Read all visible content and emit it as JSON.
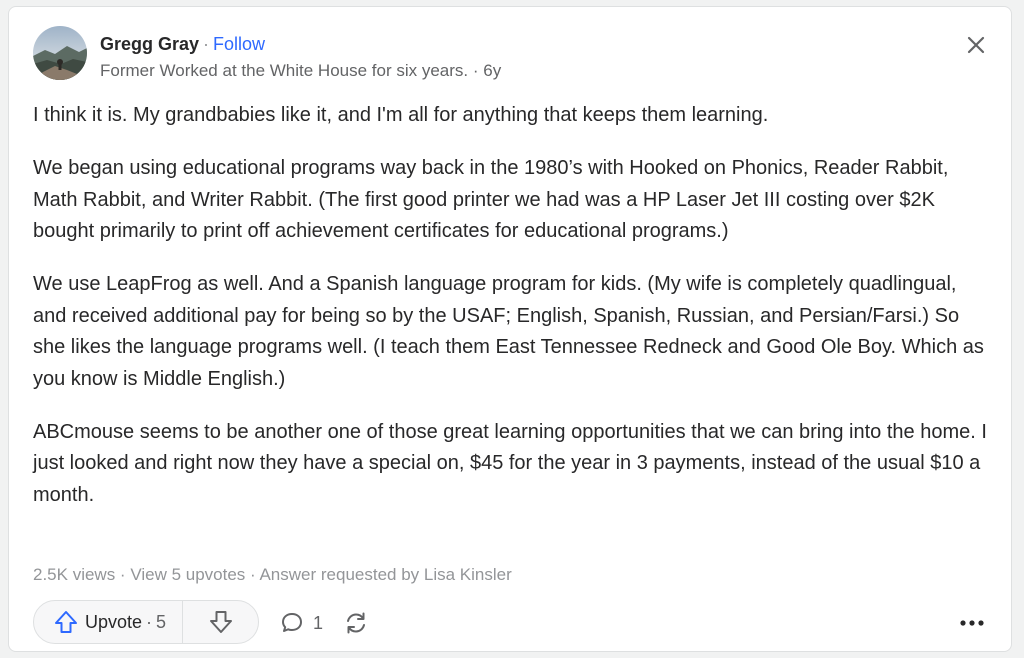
{
  "author": {
    "name": "Gregg Gray",
    "separator": "·",
    "follow_label": "Follow",
    "credential": "Former Worked at the White House for six years. · 6y"
  },
  "answer": {
    "paragraphs": [
      "I think it is. My grandbabies like it, and I'm all for anything that keeps them learning.",
      "We began using educational programs way back in the 1980’s with Hooked on Phonics, Reader Rabbit, Math Rabbit, and Writer Rabbit. (The first good printer we had was a HP Laser Jet III costing over $2K bought primarily to print off achievement certificates for educational programs.)",
      "We use LeapFrog as well. And a Spanish language program for kids. (My wife is completely quadlingual, and received additional pay for being so by the USAF; English, Spanish, Russian, and Persian/Farsi.) So she likes the language programs well. (I teach them East Tennessee Redneck and Good Ole Boy. Which as you know is Middle English.)",
      "ABCmouse seems to be another one of those great learning opportunities that we can bring into the home. I just looked and right now they have a special on, $45 for the year in 3 payments, instead of the usual $10 a month."
    ]
  },
  "stats": {
    "views": "2.5K views",
    "sep": " · ",
    "upvotes_link": "View 5 upvotes",
    "requested": "Answer requested by Lisa Kinsler"
  },
  "actions": {
    "upvote_label": "Upvote",
    "upvote_sep": "·",
    "upvote_count": "5",
    "comment_count": "1"
  },
  "icons": {
    "close": "close-icon",
    "upvote": "upvote-arrow-icon",
    "downvote": "downvote-arrow-icon",
    "comment": "comment-bubble-icon",
    "share": "share-reload-icon",
    "more": "more-dots-icon"
  },
  "colors": {
    "accent": "#2e69ff",
    "text": "#282829",
    "muted": "#939598",
    "upvote_icon": "#2e69ff"
  }
}
